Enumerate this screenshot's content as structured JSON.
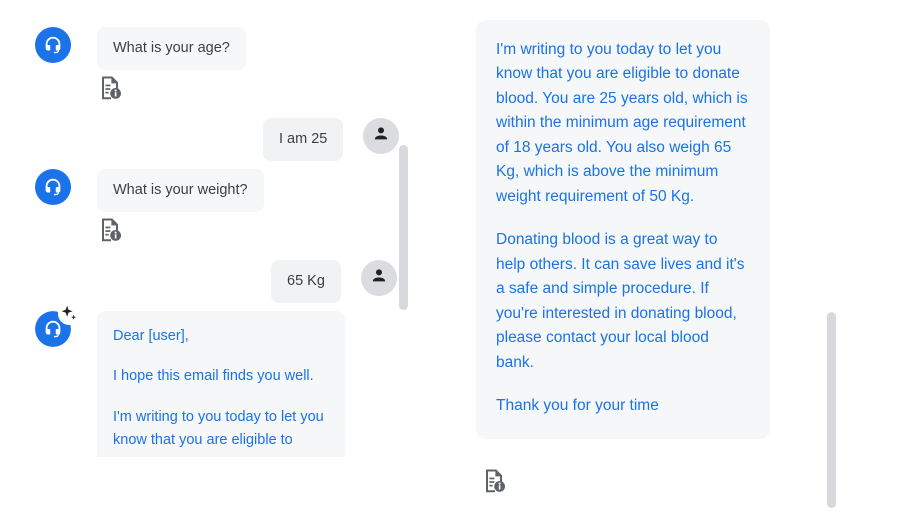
{
  "chat": {
    "scrollbar_present": true,
    "messages": [
      {
        "role": "agent",
        "avatar_icon": "headset-icon",
        "text": "What is your age?",
        "attachment_icon": "document-info-icon"
      },
      {
        "role": "user",
        "avatar_icon": "person-icon",
        "text": "I am 25"
      },
      {
        "role": "agent",
        "avatar_icon": "headset-icon",
        "text": "What is your weight?",
        "attachment_icon": "document-info-icon"
      },
      {
        "role": "user",
        "avatar_icon": "person-icon",
        "text": "65 Kg"
      },
      {
        "role": "agent",
        "avatar_icon": "headset-icon",
        "badge_icon": "sparkle-icon",
        "paragraphs": [
          "Dear [user],",
          "I hope this email finds you well.",
          "I'm writing to you today to let you know that you are eligible to"
        ]
      }
    ]
  },
  "result": {
    "attachment_icon": "document-info-icon",
    "paragraphs": [
      "I'm writing to you today to let you know that you are eligible to donate blood. You are 25 years old, which is within the minimum age requirement of 18 years old. You also weigh 65 Kg, which is above the minimum weight requirement of 50 Kg.",
      "Donating blood is a great way to help others. It can save lives and it's a safe and simple procedure. If you're interested in donating blood, please contact your local blood bank.",
      "Thank you for your time"
    ]
  },
  "colors": {
    "accent_blue": "#1a73e8",
    "bubble_gray": "#f6f7f9",
    "avatar_gray": "#dadce0",
    "text_dark": "#3c4043",
    "scrollbar": "#d7d9dd"
  }
}
